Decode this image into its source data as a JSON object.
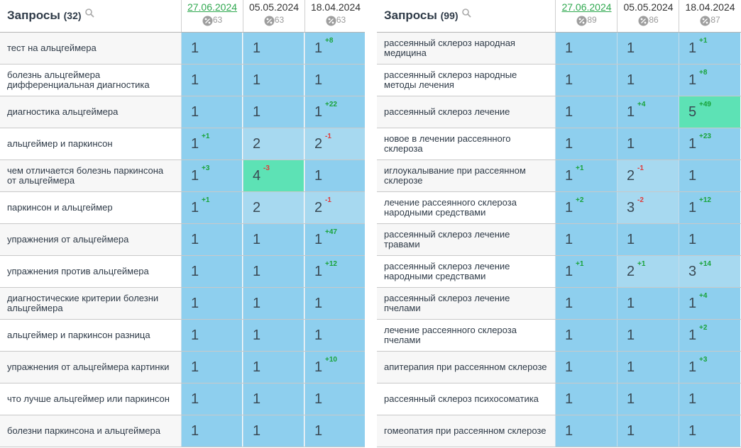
{
  "panels": [
    {
      "id": "left",
      "title": "Запросы",
      "count": "(32)",
      "columns": [
        {
          "date": "27.06.2024",
          "pct": "63",
          "active": true
        },
        {
          "date": "05.05.2024",
          "pct": "63",
          "active": false
        },
        {
          "date": "18.04.2024",
          "pct": "63",
          "active": false
        }
      ],
      "rows": [
        {
          "keyword": "тест на альцгеймера",
          "cells": [
            {
              "pos": "1"
            },
            {
              "pos": "1"
            },
            {
              "pos": "1",
              "delta": "+8",
              "dir": "up"
            }
          ]
        },
        {
          "keyword": "болезнь альцгеймера дифференциальная диагностика",
          "cells": [
            {
              "pos": "1"
            },
            {
              "pos": "1"
            },
            {
              "pos": "1"
            }
          ]
        },
        {
          "keyword": "диагностика альцгеймера",
          "cells": [
            {
              "pos": "1"
            },
            {
              "pos": "1"
            },
            {
              "pos": "1",
              "delta": "+22",
              "dir": "up"
            }
          ]
        },
        {
          "keyword": "альцгеймер и паркинсон",
          "cells": [
            {
              "pos": "1",
              "delta": "+1",
              "dir": "up"
            },
            {
              "pos": "2",
              "tone": "light"
            },
            {
              "pos": "2",
              "delta": "-1",
              "dir": "down",
              "tone": "light"
            }
          ]
        },
        {
          "keyword": "чем отличается болезнь паркинсона от альцгеймера",
          "cells": [
            {
              "pos": "1",
              "delta": "+3",
              "dir": "up"
            },
            {
              "pos": "4",
              "delta": "-3",
              "dir": "down",
              "tone": "green"
            },
            {
              "pos": "1"
            }
          ]
        },
        {
          "keyword": "паркинсон и альцгеймер",
          "cells": [
            {
              "pos": "1",
              "delta": "+1",
              "dir": "up"
            },
            {
              "pos": "2",
              "tone": "light"
            },
            {
              "pos": "2",
              "delta": "-1",
              "dir": "down",
              "tone": "light"
            }
          ]
        },
        {
          "keyword": "упражнения от альцгеймера",
          "cells": [
            {
              "pos": "1"
            },
            {
              "pos": "1"
            },
            {
              "pos": "1",
              "delta": "+47",
              "dir": "up"
            }
          ]
        },
        {
          "keyword": "упражнения против альцгеймера",
          "cells": [
            {
              "pos": "1"
            },
            {
              "pos": "1"
            },
            {
              "pos": "1",
              "delta": "+12",
              "dir": "up"
            }
          ]
        },
        {
          "keyword": "диагностические критерии болезни альцгеймера",
          "cells": [
            {
              "pos": "1"
            },
            {
              "pos": "1"
            },
            {
              "pos": "1"
            }
          ]
        },
        {
          "keyword": "альцгеймер и паркинсон разница",
          "cells": [
            {
              "pos": "1"
            },
            {
              "pos": "1"
            },
            {
              "pos": "1"
            }
          ]
        },
        {
          "keyword": "упражнения от альцгеймера картинки",
          "cells": [
            {
              "pos": "1"
            },
            {
              "pos": "1"
            },
            {
              "pos": "1",
              "delta": "+10",
              "dir": "up"
            }
          ]
        },
        {
          "keyword": "что лучше альцгеймер или паркинсон",
          "cells": [
            {
              "pos": "1"
            },
            {
              "pos": "1"
            },
            {
              "pos": "1"
            }
          ]
        },
        {
          "keyword": "болезни паркинсона и альцгеймера",
          "cells": [
            {
              "pos": "1"
            },
            {
              "pos": "1"
            },
            {
              "pos": "1"
            }
          ]
        }
      ]
    },
    {
      "id": "right",
      "title": "Запросы",
      "count": "(99)",
      "columns": [
        {
          "date": "27.06.2024",
          "pct": "89",
          "active": true
        },
        {
          "date": "05.05.2024",
          "pct": "86",
          "active": false
        },
        {
          "date": "18.04.2024",
          "pct": "87",
          "active": false
        }
      ],
      "rows": [
        {
          "keyword": "рассеянный склероз народная медицина",
          "cells": [
            {
              "pos": "1"
            },
            {
              "pos": "1"
            },
            {
              "pos": "1",
              "delta": "+1",
              "dir": "up"
            }
          ]
        },
        {
          "keyword": "рассеянный склероз народные методы лечения",
          "cells": [
            {
              "pos": "1"
            },
            {
              "pos": "1"
            },
            {
              "pos": "1",
              "delta": "+8",
              "dir": "up"
            }
          ]
        },
        {
          "keyword": "рассеянный склероз лечение",
          "cells": [
            {
              "pos": "1"
            },
            {
              "pos": "1",
              "delta": "+4",
              "dir": "up"
            },
            {
              "pos": "5",
              "delta": "+49",
              "dir": "up",
              "tone": "green"
            }
          ]
        },
        {
          "keyword": "новое в лечении рассеянного склероза",
          "cells": [
            {
              "pos": "1"
            },
            {
              "pos": "1"
            },
            {
              "pos": "1",
              "delta": "+23",
              "dir": "up"
            }
          ]
        },
        {
          "keyword": "иглоукалывание при рассеянном склерозе",
          "cells": [
            {
              "pos": "1",
              "delta": "+1",
              "dir": "up"
            },
            {
              "pos": "2",
              "delta": "-1",
              "dir": "down",
              "tone": "light"
            },
            {
              "pos": "1"
            }
          ]
        },
        {
          "keyword": "лечение рассеянного склероза народными средствами",
          "cells": [
            {
              "pos": "1",
              "delta": "+2",
              "dir": "up"
            },
            {
              "pos": "3",
              "delta": "-2",
              "dir": "down",
              "tone": "light"
            },
            {
              "pos": "1",
              "delta": "+12",
              "dir": "up"
            }
          ]
        },
        {
          "keyword": "рассеянный склероз лечение травами",
          "cells": [
            {
              "pos": "1"
            },
            {
              "pos": "1"
            },
            {
              "pos": "1"
            }
          ]
        },
        {
          "keyword": "рассеянный склероз лечение народными средствами",
          "cells": [
            {
              "pos": "1",
              "delta": "+1",
              "dir": "up"
            },
            {
              "pos": "2",
              "delta": "+1",
              "dir": "up",
              "tone": "light"
            },
            {
              "pos": "3",
              "delta": "+14",
              "dir": "up",
              "tone": "light"
            }
          ]
        },
        {
          "keyword": "рассеянный склероз лечение пчелами",
          "cells": [
            {
              "pos": "1"
            },
            {
              "pos": "1"
            },
            {
              "pos": "1",
              "delta": "+4",
              "dir": "up"
            }
          ]
        },
        {
          "keyword": "лечение рассеянного склероза пчелами",
          "cells": [
            {
              "pos": "1"
            },
            {
              "pos": "1"
            },
            {
              "pos": "1",
              "delta": "+2",
              "dir": "up"
            }
          ]
        },
        {
          "keyword": "апитерапия при рассеянном склерозе",
          "cells": [
            {
              "pos": "1"
            },
            {
              "pos": "1"
            },
            {
              "pos": "1",
              "delta": "+3",
              "dir": "up"
            }
          ]
        },
        {
          "keyword": "рассеянный склероз психосоматика",
          "cells": [
            {
              "pos": "1"
            },
            {
              "pos": "1"
            },
            {
              "pos": "1"
            }
          ]
        },
        {
          "keyword": "гомеопатия при рассеянном склерозе",
          "cells": [
            {
              "pos": "1"
            },
            {
              "pos": "1"
            },
            {
              "pos": "1"
            }
          ]
        }
      ]
    }
  ]
}
